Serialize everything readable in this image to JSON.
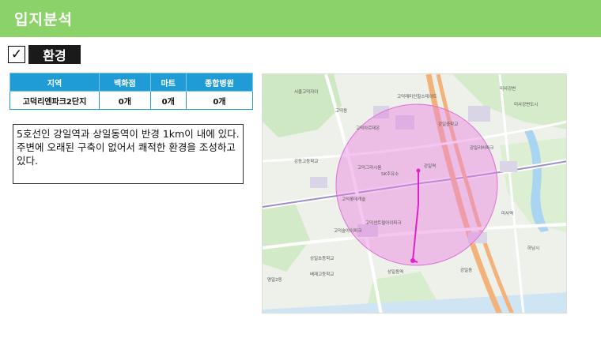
{
  "header": {
    "title": "입지분석"
  },
  "section": {
    "check": "✓",
    "label": "환경"
  },
  "table": {
    "headers": [
      "지역",
      "백화점",
      "마트",
      "종합병원"
    ],
    "row": [
      "고덕리엔파크2단지",
      "0개",
      "0개",
      "0개"
    ]
  },
  "description": {
    "line1": "5호선인 강일역과 상일동역이 반경 1km이 내에 있다.",
    "line2": "주변에 오래된 구축이 없어서 쾌적한 환경을 조성하고 있다."
  },
  "map": {
    "labels": [
      "서울고덕자이",
      "고덕그라시움",
      "고덕아르테온",
      "고덕래미안힐스테이트",
      "강일리버파크",
      "미사강변",
      "SK주유소",
      "강동고등학교",
      "고덕롯데캐슬",
      "상일초등학교",
      "강일동",
      "하남시",
      "미사역",
      "상일동역",
      "강일역",
      "고덕센트럴아이파크",
      "고덕숲아이파크",
      "배재고등학교",
      "명일2동",
      "미사강변도시",
      "고덕동",
      "강일중학교"
    ],
    "colors": {
      "circle": "#e880e0",
      "route": "#e020c8",
      "header": "#8bd269",
      "table_header": "#1f9bd6"
    }
  }
}
